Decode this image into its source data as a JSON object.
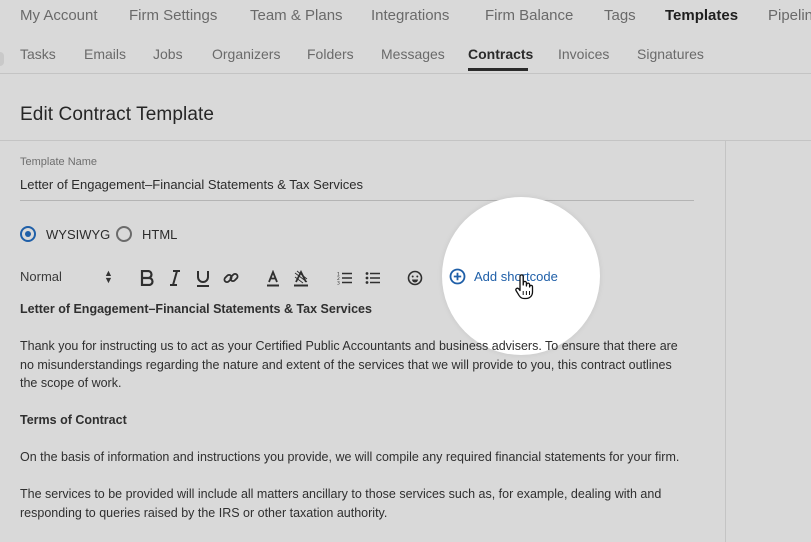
{
  "top_nav": {
    "items": [
      {
        "label": "My Account",
        "active": false
      },
      {
        "label": "Firm Settings",
        "active": false
      },
      {
        "label": "Team & Plans",
        "active": false
      },
      {
        "label": "Integrations",
        "active": false
      },
      {
        "label": "Firm Balance",
        "active": false
      },
      {
        "label": "Tags",
        "active": false
      },
      {
        "label": "Templates",
        "active": true
      },
      {
        "label": "Pipelin",
        "active": false
      }
    ]
  },
  "sub_nav": {
    "items": [
      {
        "label": "Tasks"
      },
      {
        "label": "Emails"
      },
      {
        "label": "Jobs"
      },
      {
        "label": "Organizers"
      },
      {
        "label": "Folders"
      },
      {
        "label": "Messages"
      },
      {
        "label": "Contracts"
      },
      {
        "label": "Invoices"
      },
      {
        "label": "Signatures"
      }
    ],
    "active": "Contracts"
  },
  "page": {
    "title": "Edit Contract Template"
  },
  "form": {
    "template_name_label": "Template Name",
    "template_name_value": "Letter of Engagement–Financial Statements & Tax Services",
    "mode_options": [
      {
        "label": "WYSIWYG",
        "checked": true
      },
      {
        "label": "HTML",
        "checked": false
      }
    ]
  },
  "toolbar": {
    "format_value": "Normal",
    "icons": [
      "bold-icon",
      "italic-icon",
      "underline-icon",
      "link-icon",
      "text-color-icon",
      "highlight-icon",
      "ordered-list-icon",
      "bullet-list-icon",
      "emoji-icon"
    ],
    "add_shortcode_label": "Add shortcode"
  },
  "document": {
    "heading": "Letter of Engagement–Financial Statements & Tax Services",
    "para1": "Thank you for instructing us to act as your Certified Public Accountants and business advisers. To ensure that there are no misunderstandings regarding the nature and extent of the services that we will provide to you, this contract outlines the scope of work.",
    "section_heading": "Terms of Contract",
    "para2": "On the basis of information and instructions you provide, we will compile any required financial statements for your firm.",
    "para3": "The services to be provided will include all matters ancillary to those services such as, for example, dealing with and responding to queries raised by the IRS or other taxation authority."
  },
  "colors": {
    "background": "#d9d9d9",
    "accent": "#1f5fa8",
    "spotlight": "#ffffff"
  }
}
